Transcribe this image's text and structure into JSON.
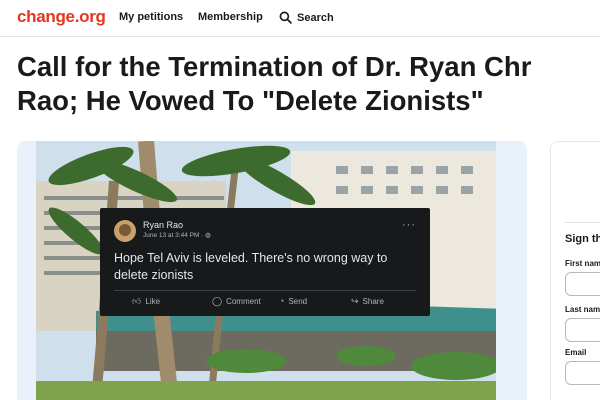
{
  "header": {
    "logo": "change.org",
    "nav": {
      "my_petitions": "My petitions",
      "membership": "Membership",
      "search": "Search"
    }
  },
  "petition": {
    "title_line1": "Call for the Termination of Dr. Ryan Chr",
    "title_line2": "Rao; He Vowed To \"Delete Zionists\""
  },
  "post": {
    "author": "Ryan Rao",
    "time": "June 13 at 3:44 PM · ",
    "text": "Hope Tel Aviv is leveled. There's no wrong way to delete zionists",
    "more": "···",
    "actions": {
      "like": "Like",
      "comment": "Comment",
      "send": "Send",
      "share": "Share"
    }
  },
  "sign_form": {
    "heading": "Sign th",
    "first_name_label": "First nam",
    "last_name_label": "Last nam",
    "email_label": "Email"
  },
  "colors": {
    "brand": "#e8351f",
    "post_bg": "#18191a",
    "media_bg": "#e9f1fb"
  }
}
